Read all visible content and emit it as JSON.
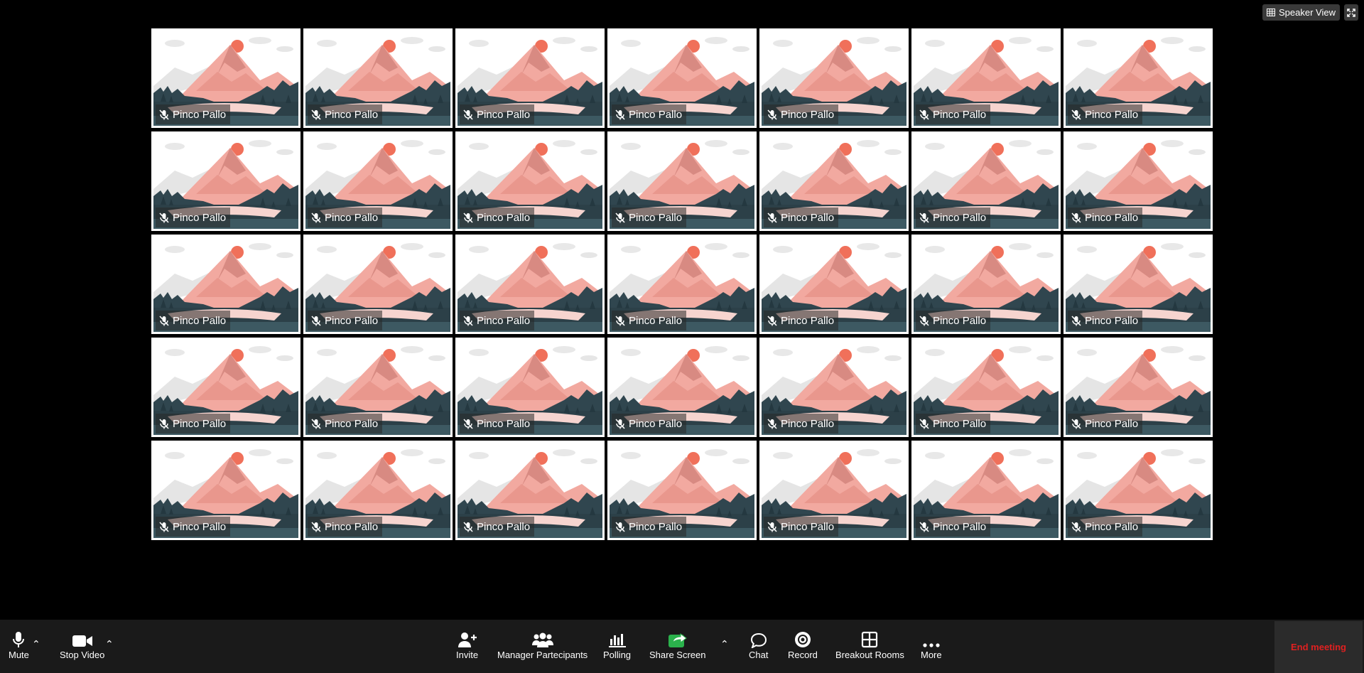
{
  "view": {
    "speaker_view_label": "Speaker View"
  },
  "participants": [
    "Pinco Pallo",
    "Pinco Pallo",
    "Pinco Pallo",
    "Pinco Pallo",
    "Pinco Pallo",
    "Pinco Pallo",
    "Pinco Pallo",
    "Pinco Pallo",
    "Pinco Pallo",
    "Pinco Pallo",
    "Pinco Pallo",
    "Pinco Pallo",
    "Pinco Pallo",
    "Pinco Pallo",
    "Pinco Pallo",
    "Pinco Pallo",
    "Pinco Pallo",
    "Pinco Pallo",
    "Pinco Pallo",
    "Pinco Pallo",
    "Pinco Pallo",
    "Pinco Pallo",
    "Pinco Pallo",
    "Pinco Pallo",
    "Pinco Pallo",
    "Pinco Pallo",
    "Pinco Pallo",
    "Pinco Pallo",
    "Pinco Pallo",
    "Pinco Pallo",
    "Pinco Pallo",
    "Pinco Pallo",
    "Pinco Pallo",
    "Pinco Pallo",
    "Pinco Pallo"
  ],
  "toolbar": {
    "mute": "Mute",
    "stop_video": "Stop Video",
    "invite": "Invite",
    "manage_participants": "Manager Partecipants",
    "polling": "Polling",
    "share_screen": "Share Screen",
    "chat": "Chat",
    "record": "Record",
    "breakout_rooms": "Breakout Rooms",
    "more": "More",
    "end_meeting": "End meeting"
  },
  "colors": {
    "share_green": "#2bb24c",
    "end_red": "#e02020"
  }
}
